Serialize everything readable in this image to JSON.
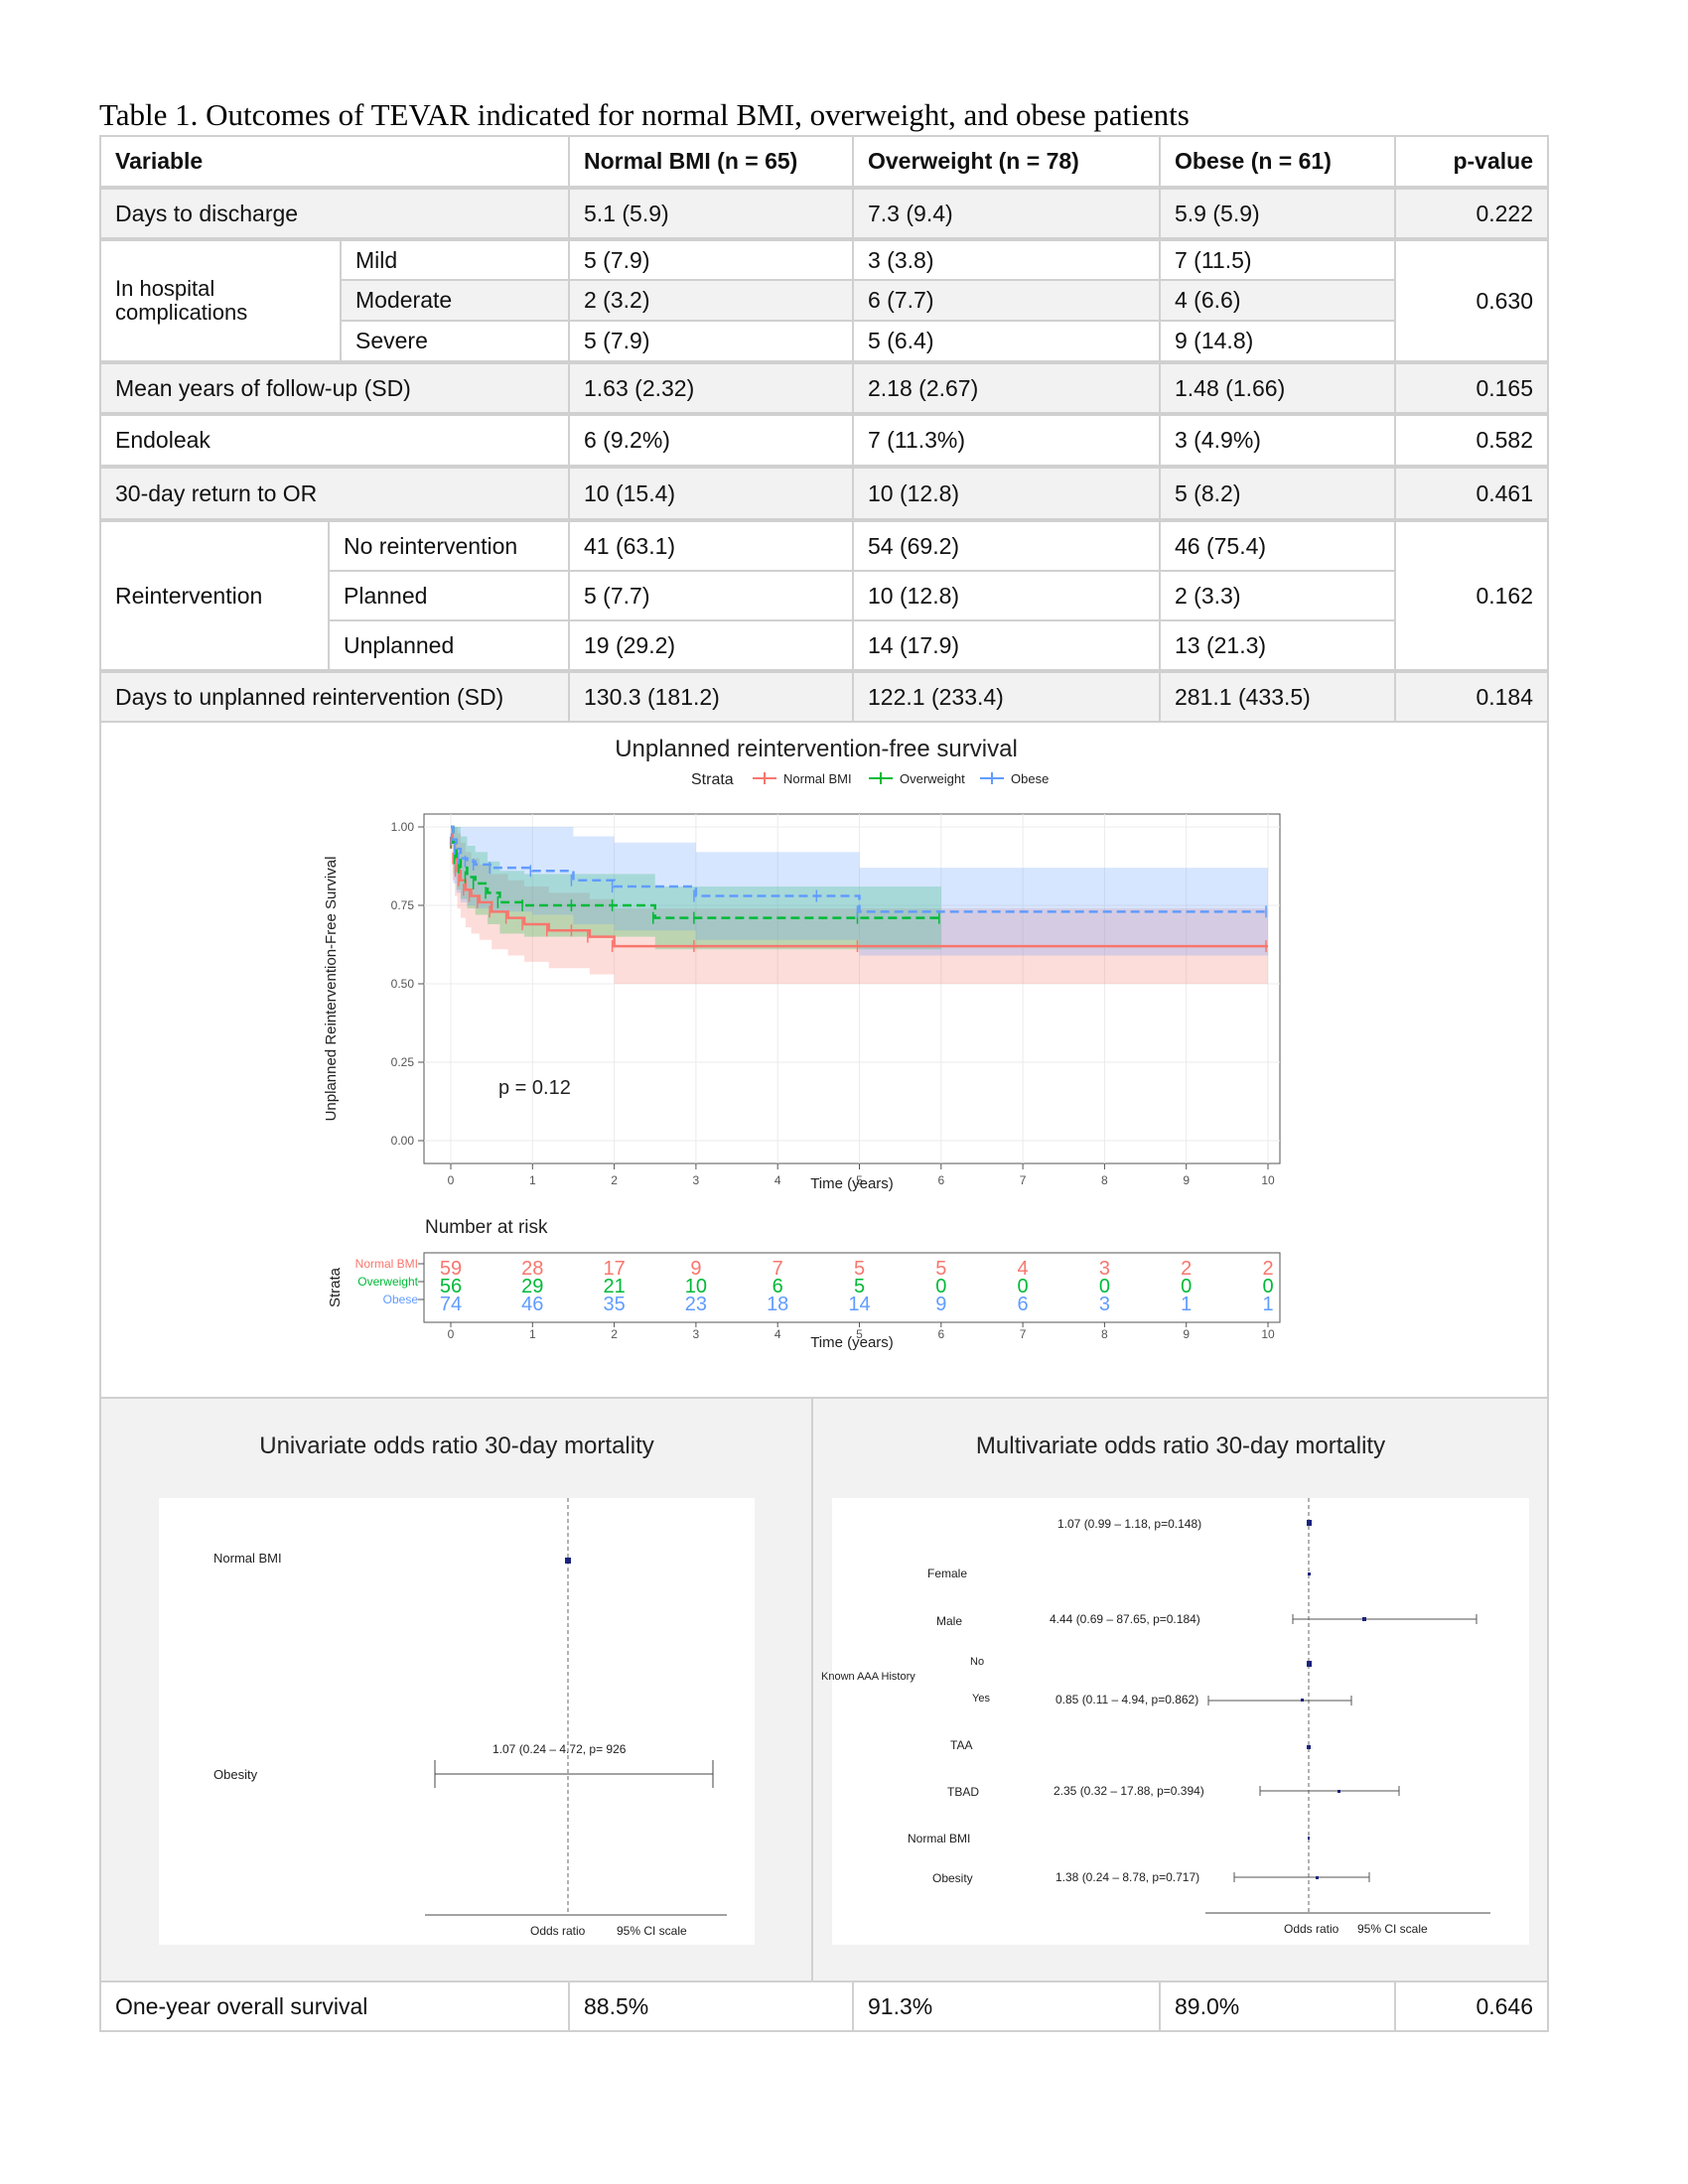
{
  "caption": "Table 1. Outcomes of TEVAR indicated for normal BMI, overweight, and obese patients",
  "header": {
    "variable": "Variable",
    "normal": "Normal BMI (n = 65)",
    "overweight": "Overweight (n = 78)",
    "obese": "Obese (n = 61)",
    "p": "p-value"
  },
  "rows": {
    "days_discharge": {
      "label": "Days to discharge",
      "normal": "5.1 (5.9)",
      "overweight": "7.3 (9.4)",
      "obese": "5.9 (5.9)",
      "p": "0.222"
    },
    "complications": {
      "label": "In hospital complications",
      "p": "0.630",
      "sub": [
        {
          "label": "Mild",
          "normal": "5 (7.9)",
          "overweight": "3 (3.8)",
          "obese": "7 (11.5)"
        },
        {
          "label": "Moderate",
          "normal": "2 (3.2)",
          "overweight": "6 (7.7)",
          "obese": "4 (6.6)"
        },
        {
          "label": "Severe",
          "normal": "5 (7.9)",
          "overweight": "5 (6.4)",
          "obese": "9 (14.8)"
        }
      ]
    },
    "followup": {
      "label": "Mean years of follow-up (SD)",
      "normal": "1.63 (2.32)",
      "overweight": "2.18 (2.67)",
      "obese": "1.48 (1.66)",
      "p": "0.165"
    },
    "endoleak": {
      "label": "Endoleak",
      "normal": "6 (9.2%)",
      "overweight": "7 (11.3%)",
      "obese": "3 (4.9%)",
      "p": "0.582"
    },
    "return_or": {
      "label": "30-day return to OR",
      "normal": "10 (15.4)",
      "overweight": "10 (12.8)",
      "obese": "5 (8.2)",
      "p": "0.461"
    },
    "reintervention": {
      "label": "Reintervention",
      "p": "0.162",
      "sub": [
        {
          "label": "No reintervention",
          "normal": "41 (63.1)",
          "overweight": "54 (69.2)",
          "obese": "46 (75.4)"
        },
        {
          "label": "Planned",
          "normal": "5 (7.7)",
          "overweight": "10 (12.8)",
          "obese": "2 (3.3)"
        },
        {
          "label": "Unplanned",
          "normal": "19 (29.2)",
          "overweight": "14 (17.9)",
          "obese": "13 (21.3)"
        }
      ]
    },
    "days_unplanned": {
      "label": "Days to unplanned reintervention (SD)",
      "normal": "130.3 (181.2)",
      "overweight": "122.1 (233.4)",
      "obese": "281.1 (433.5)",
      "p": "0.184"
    },
    "one_year": {
      "label": "One-year overall survival",
      "normal": "88.5%",
      "overweight": "91.3%",
      "obese": "89.0%",
      "p": "0.646"
    }
  },
  "km": {
    "panel_title": "Unplanned reintervention-free survival",
    "legend_title": "Strata",
    "p_label": "p = 0.12",
    "risk_title": "Number at risk",
    "risk_ylabel": "Strata",
    "colors": {
      "normal": "#f8766d",
      "overweight": "#00ba38",
      "obese": "#619cff"
    },
    "chart_data": {
      "type": "line",
      "xlabel": "Time (years)",
      "ylabel": "Unplanned Reintervention-Free Survival",
      "xlim": [
        0,
        10
      ],
      "ylim": [
        0,
        1
      ],
      "xticks": [
        "0",
        "1",
        "2",
        "3",
        "4",
        "5",
        "6",
        "7",
        "8",
        "9",
        "10"
      ],
      "yticks": [
        "0.00",
        "0.25",
        "0.50",
        "0.75",
        "1.00"
      ],
      "series": [
        {
          "name": "Normal BMI",
          "x": [
            0,
            0.02,
            0.05,
            0.08,
            0.12,
            0.18,
            0.25,
            0.35,
            0.5,
            0.7,
            0.9,
            1.2,
            1.5,
            1.7,
            2.0,
            3.0,
            5.0,
            10.0
          ],
          "y": [
            1.0,
            0.95,
            0.9,
            0.86,
            0.83,
            0.8,
            0.78,
            0.76,
            0.73,
            0.71,
            0.69,
            0.67,
            0.67,
            0.65,
            0.62,
            0.62,
            0.62,
            0.62
          ]
        },
        {
          "name": "Overweight",
          "x": [
            0,
            0.03,
            0.07,
            0.12,
            0.2,
            0.3,
            0.45,
            0.6,
            0.9,
            1.5,
            2.0,
            2.5,
            3.0,
            5.0,
            6.0
          ],
          "y": [
            1.0,
            0.95,
            0.9,
            0.87,
            0.84,
            0.82,
            0.79,
            0.76,
            0.75,
            0.75,
            0.75,
            0.71,
            0.71,
            0.71,
            0.71
          ]
        },
        {
          "name": "Obese",
          "x": [
            0,
            0.03,
            0.07,
            0.12,
            0.2,
            0.3,
            0.5,
            1.0,
            1.5,
            2.0,
            3.0,
            4.5,
            5.0,
            10.0
          ],
          "y": [
            1.0,
            0.96,
            0.93,
            0.9,
            0.89,
            0.88,
            0.87,
            0.86,
            0.83,
            0.81,
            0.78,
            0.78,
            0.73,
            0.73
          ]
        }
      ]
    },
    "risk": [
      {
        "name": "Normal BMI",
        "values": [
          "59",
          "28",
          "17",
          "9",
          "7",
          "5",
          "5",
          "4",
          "3",
          "2",
          "2"
        ]
      },
      {
        "name": "Overweight",
        "values": [
          "56",
          "29",
          "21",
          "10",
          "6",
          "5",
          "0",
          "0",
          "0",
          "0",
          "0"
        ]
      },
      {
        "name": "Obese",
        "values": [
          "74",
          "46",
          "35",
          "23",
          "18",
          "14",
          "9",
          "6",
          "3",
          "1",
          "1"
        ]
      }
    ]
  },
  "uni": {
    "panel_title": "Univariate odds ratio 30-day mortality",
    "labels": [
      "Normal BMI",
      "Obesity"
    ],
    "ci_text": "1.07 (0.24 – 4.72, p= 926",
    "xlabel": "Odds ratio",
    "scale_label": "95% CI scale"
  },
  "multi": {
    "panel_title": "Multivariate odds ratio 30-day mortality",
    "top_text": "1.07 (0.99 – 1.18, p=0.148)",
    "labels": {
      "female": "Female",
      "male": "Male",
      "aaa": "Known AAA History",
      "no": "No",
      "yes": "Yes",
      "taa": "TAA",
      "tbad": "TBAD",
      "normal": "Normal BMI",
      "obesity": "Obesity"
    },
    "ci": {
      "male": "4.44 (0.69 – 87.65, p=0.184)",
      "yes": "0.85 (0.11 – 4.94, p=0.862)",
      "tbad": "2.35 (0.32 – 17.88, p=0.394)",
      "obesity": "1.38 (0.24 – 8.78, p=0.717)"
    },
    "xlabel": "Odds ratio",
    "scale_label": "95% CI scale"
  }
}
